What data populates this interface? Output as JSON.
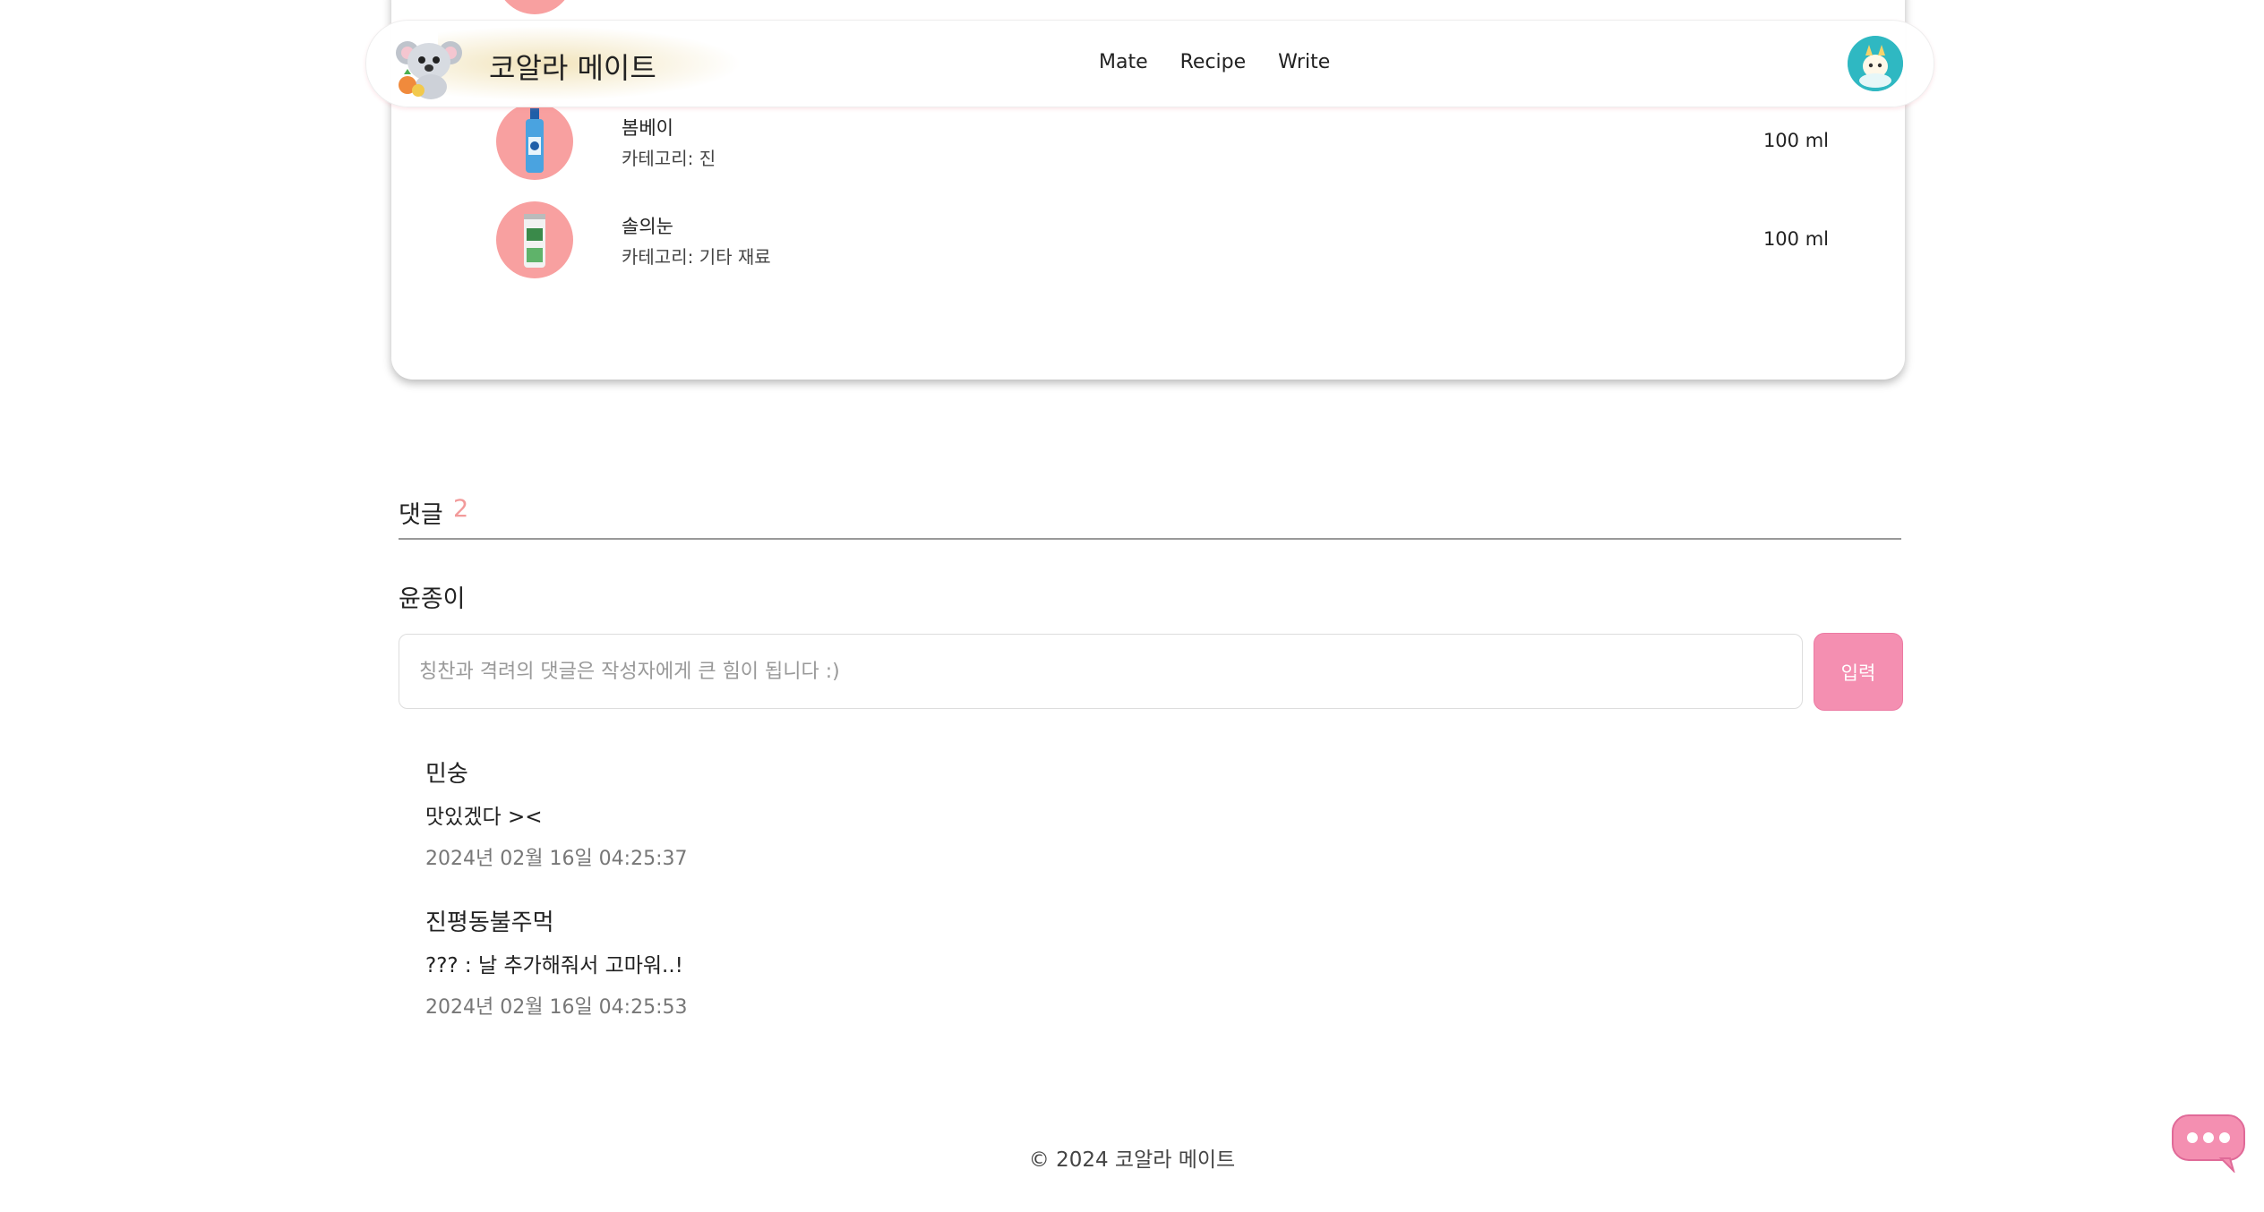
{
  "header": {
    "brand": "코알라 메이트",
    "nav": [
      "Mate",
      "Recipe",
      "Write"
    ]
  },
  "ingredients": [
    {
      "name": "봄베이",
      "category": "카테고리: 진",
      "amount": "100 ml",
      "thumb_color": "#f8a0a0"
    },
    {
      "name": "솔의눈",
      "category": "카테고리: 기타 재료",
      "amount": "100 ml",
      "thumb_color": "#f8a0a0"
    }
  ],
  "comments_section": {
    "title": "댓글",
    "count": "2",
    "current_user": "윤종이",
    "input_placeholder": "칭찬과 격려의 댓글은 작성자에게 큰 힘이 됩니다 :)",
    "submit_label": "입력",
    "items": [
      {
        "author": "민숭",
        "text": "맛있겠다 ><",
        "date": "2024년 02월 16일 04:25:37"
      },
      {
        "author": "진평동불주먹",
        "text": "??? : 날 추가해줘서 고마워..!",
        "date": "2024년 02월 16일 04:25:53"
      }
    ]
  },
  "footer": {
    "copyright": "© 2024 코알라 메이트"
  },
  "icons": {
    "logo": "koala-logo-icon",
    "avatar": "user-avatar",
    "chat": "chat-bubble-icon"
  },
  "colors": {
    "accent_pink": "#f48fb1",
    "count_color": "#f29a9a",
    "thumb_bg": "#f8a0a0"
  }
}
